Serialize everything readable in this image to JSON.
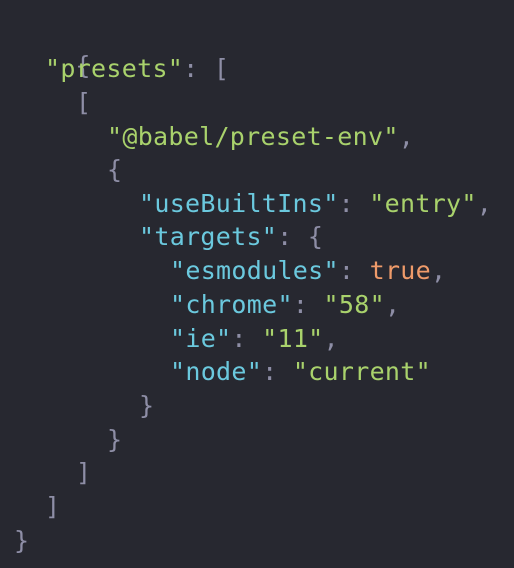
{
  "code": {
    "open_root": "{",
    "presets_key": "\"presets\"",
    "colon": ":",
    "comma": ",",
    "open_array": "[",
    "close_array": "]",
    "open_brace": "{",
    "close_brace": "}",
    "preset_name": "\"@babel/preset-env\"",
    "use_built_ins_key": "\"useBuiltIns\"",
    "use_built_ins_value": "\"entry\"",
    "targets_key": "\"targets\"",
    "esmodules_key": "\"esmodules\"",
    "esmodules_value": "true",
    "chrome_key": "\"chrome\"",
    "chrome_value": "\"58\"",
    "ie_key": "\"ie\"",
    "ie_value": "\"11\"",
    "node_key": "\"node\"",
    "node_value": "\"current\"",
    "close_root": "}"
  },
  "colors": {
    "background": "#272830",
    "punctuation": "#8e8ea6",
    "key": "#6bc9de",
    "string": "#a9d26c",
    "boolean": "#ef9b6a"
  }
}
